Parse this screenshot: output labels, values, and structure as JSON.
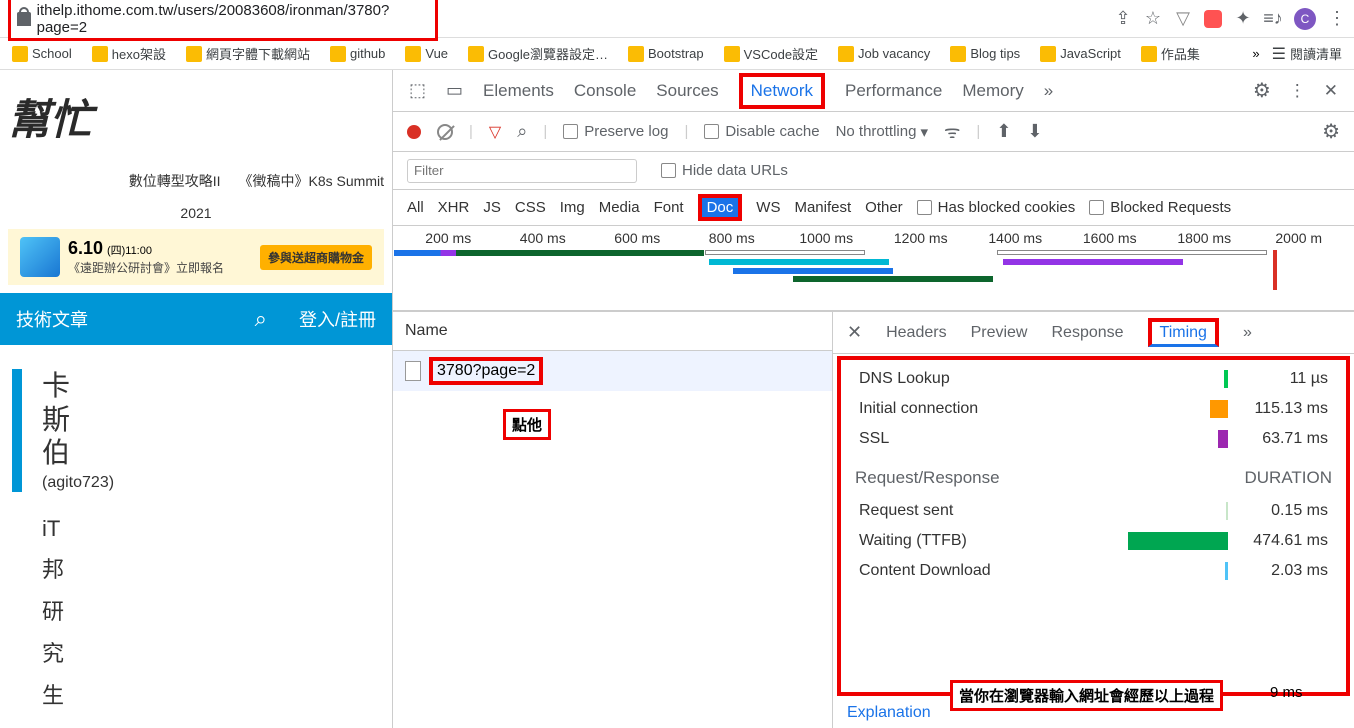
{
  "url": "ithelp.ithome.com.tw/users/20083608/ironman/3780?page=2",
  "toolbar_icons": {
    "avatar": "C"
  },
  "bookmarks": [
    "School",
    "hexo架設",
    "網頁字體下載網站",
    "github",
    "Vue",
    "Google瀏覽器設定…",
    "Bootstrap",
    "VSCode設定",
    "Job vacancy",
    "Blog tips",
    "JavaScript",
    "作品集"
  ],
  "bookmarks_chevron": "»",
  "bookmarks_right": "閱讀清單",
  "page": {
    "logo": "幫忙",
    "tag1": "數位轉型攻略II",
    "tag2": "《徵稿中》K8s Summit",
    "tag3": "2021",
    "banner_big": "6.10",
    "banner_date": "(四)11:00",
    "banner_sub": "《遠距辦公研討會》立即報名",
    "banner_btn": "參與送超商購物金",
    "menu_item": "技術文章",
    "menu_login": "登入/註冊",
    "profile_name_lines": [
      "卡",
      "斯",
      "伯"
    ],
    "profile_handle": "(agito723)",
    "profile_links": [
      "iT",
      "邦",
      "研",
      "究",
      "生"
    ]
  },
  "devtools": {
    "tabs": [
      "Elements",
      "Console",
      "Sources",
      "Network",
      "Performance",
      "Memory"
    ],
    "tabs_more": "»",
    "toolbar": {
      "preserve": "Preserve log",
      "disable_cache": "Disable cache",
      "throttling": "No throttling"
    },
    "filter_placeholder": "Filter",
    "hide_urls": "Hide data URLs",
    "types": [
      "All",
      "XHR",
      "JS",
      "CSS",
      "Img",
      "Media",
      "Font",
      "Doc",
      "WS",
      "Manifest",
      "Other"
    ],
    "has_blocked": "Has blocked cookies",
    "blocked_req": "Blocked Requests",
    "timeline_ticks": [
      "200 ms",
      "400 ms",
      "600 ms",
      "800 ms",
      "1000 ms",
      "1200 ms",
      "1400 ms",
      "1600 ms",
      "1800 ms",
      "2000 m"
    ],
    "name_col": "Name",
    "request_name": "3780?page=2",
    "annot_click": "點他",
    "detail_tabs": [
      "Headers",
      "Preview",
      "Response",
      "Timing"
    ],
    "detail_more": "»",
    "rows": [
      {
        "name": "DNS Lookup",
        "bar": "#00c853",
        "barW": "4px",
        "val": "11 µs"
      },
      {
        "name": "Initial connection",
        "bar": "#ff9800",
        "barW": "18px",
        "val": "115.13 ms"
      },
      {
        "name": "SSL",
        "bar": "#9c27b0",
        "barW": "10px",
        "val": "63.71 ms"
      }
    ],
    "sect": "Request/Response",
    "sect_r": "DURATION",
    "rows2": [
      {
        "name": "Request sent",
        "bar": "#d1e8d1",
        "barW": "2px",
        "val": "0.15 ms"
      },
      {
        "name": "Waiting (TTFB)",
        "bar": "#00a651",
        "barW": "100px",
        "val": "474.61 ms"
      },
      {
        "name": "Content Download",
        "bar": "#4fc3f7",
        "barW": "2px",
        "val": "2.03 ms"
      }
    ],
    "explanation": "Explanation",
    "annot_bottom": "當你在瀏覽器輸入網址會經歷以上過程",
    "trailing": "9 ms"
  }
}
